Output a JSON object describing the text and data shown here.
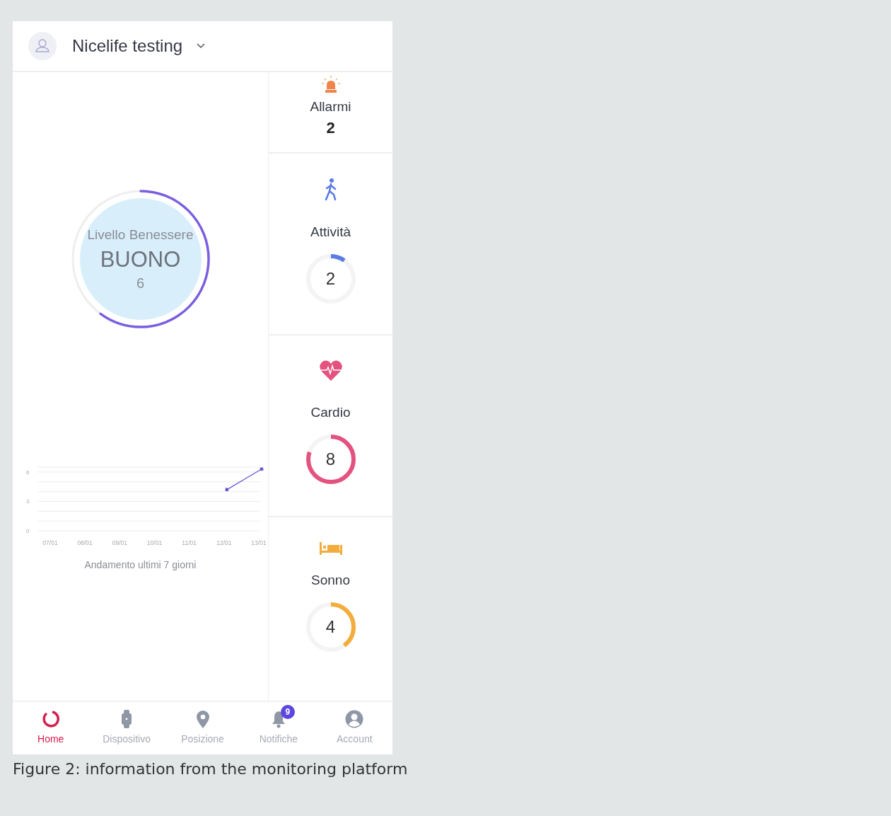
{
  "header": {
    "title": "Nicelife testing"
  },
  "wellness": {
    "label": "Livello Benessere",
    "rating": "BUONO",
    "value": "6",
    "level": 0.6
  },
  "chart": {
    "chart_data": {
      "type": "line",
      "title": "Andamento ultimi 7 giorni",
      "categories": [
        "07/01",
        "08/01",
        "09/01",
        "10/01",
        "11/01",
        "12/01",
        "13/01"
      ],
      "series": [
        {
          "color": "#6a5acd",
          "values": [
            null,
            null,
            null,
            null,
            null,
            4.2,
            6.3
          ]
        }
      ],
      "ylim": [
        0,
        6.5
      ],
      "yticks": [
        0,
        3,
        6
      ]
    }
  },
  "alarms": {
    "label": "Allarmi",
    "count": "2"
  },
  "metrics": [
    {
      "kind": "activity",
      "label": "Attività",
      "value": "2",
      "level": 0.1,
      "color": "#5b7be6"
    },
    {
      "kind": "cardio",
      "label": "Cardio",
      "value": "8",
      "level": 0.8,
      "color": "#e4527f"
    },
    {
      "kind": "sleep",
      "label": "Sonno",
      "value": "4",
      "level": 0.4,
      "color": "#f2ad3c"
    }
  ],
  "nav": [
    {
      "kind": "home",
      "label": "Home",
      "selected": true
    },
    {
      "kind": "device",
      "label": "Dispositivo",
      "selected": false
    },
    {
      "kind": "location",
      "label": "Posizione",
      "selected": false
    },
    {
      "kind": "notifications",
      "label": "Notifiche",
      "selected": false,
      "badge": "9"
    },
    {
      "kind": "account",
      "label": "Account",
      "selected": false
    }
  ],
  "caption": "Figure 2: information from the monitoring platform"
}
